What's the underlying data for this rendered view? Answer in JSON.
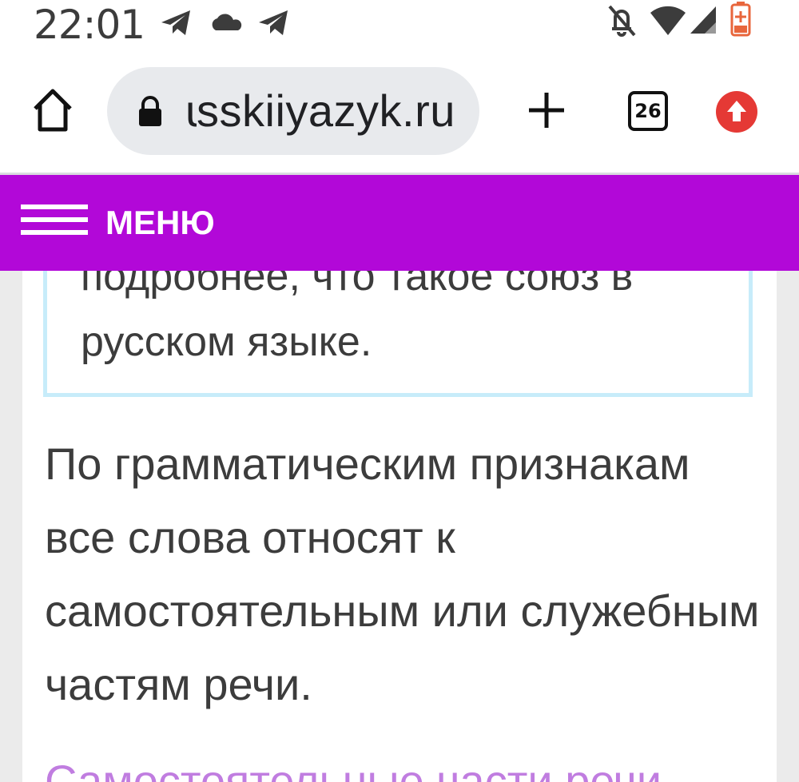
{
  "status_bar": {
    "time": "22:01",
    "left_icons": [
      "telegram-icon",
      "cloud-icon",
      "telegram-icon"
    ],
    "right_icons": [
      "notifications-off-icon",
      "wifi-icon",
      "signal-icon",
      "battery-charging-icon"
    ]
  },
  "browser": {
    "url": "usskiiyazyk.ru",
    "url_cut_prefix": "u",
    "url_visible": "sskiiyazyk.ru",
    "tab_count": "26",
    "icons": [
      "home-icon",
      "lock-icon",
      "plus-icon",
      "tabs-icon",
      "update-icon"
    ]
  },
  "site_menu": {
    "label": "МЕНЮ"
  },
  "article": {
    "info_box_partial_line": "подробнее, что такое союз в",
    "info_box_last_line": "русском языке.",
    "paragraph": "По грамматическим признакам все слова относят к самостоятельным или служебным частям речи.",
    "next_heading": "Самостоятельные части речи"
  },
  "colors": {
    "menu_bar": "#b208d8",
    "info_border": "#c7ecfa",
    "link": "#c07de0",
    "update_button": "#e53935"
  }
}
